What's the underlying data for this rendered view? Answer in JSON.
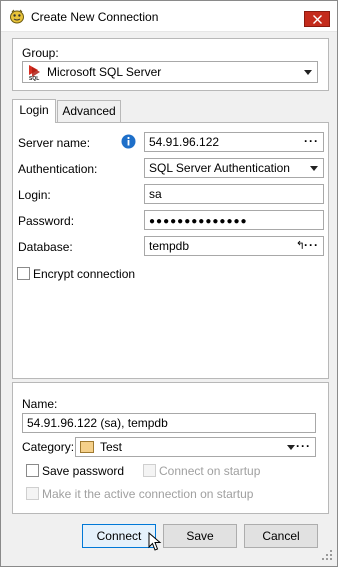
{
  "window": {
    "title": "Create New Connection"
  },
  "group": {
    "label": "Group:",
    "value": "Microsoft SQL Server",
    "icon": "sql-server-icon"
  },
  "tabs": [
    {
      "label": "Login",
      "active": true
    },
    {
      "label": "Advanced",
      "active": false
    }
  ],
  "login": {
    "server_name": {
      "label": "Server name:",
      "value": "54.91.96.122",
      "info_icon": "info-icon",
      "more": "···"
    },
    "authentication": {
      "label": "Authentication:",
      "value": "SQL Server Authentication"
    },
    "login": {
      "label": "Login:",
      "value": "sa"
    },
    "password": {
      "label": "Password:",
      "value": "●●●●●●●●●●●●●●"
    },
    "database": {
      "label": "Database:",
      "value": "tempdb",
      "refresh": "↰",
      "more": "···"
    },
    "encrypt": {
      "label": "Encrypt connection",
      "checked": false
    }
  },
  "details": {
    "name_label": "Name:",
    "name_value": "54.91.96.122 (sa), tempdb",
    "category_label": "Category:",
    "category_value": "Test",
    "category_color": "#f5d08a",
    "category_more": "···",
    "save_password": {
      "label": "Save password",
      "checked": false
    },
    "connect_on_startup": {
      "label": "Connect on startup",
      "checked": false,
      "disabled": true
    },
    "make_active": {
      "label": "Make it the active connection on startup",
      "checked": false,
      "disabled": true
    }
  },
  "buttons": {
    "connect": "Connect",
    "save": "Save",
    "cancel": "Cancel"
  },
  "colors": {
    "close": "#c42b1c",
    "info": "#1e6fc9",
    "primary_border": "#0078d7"
  }
}
